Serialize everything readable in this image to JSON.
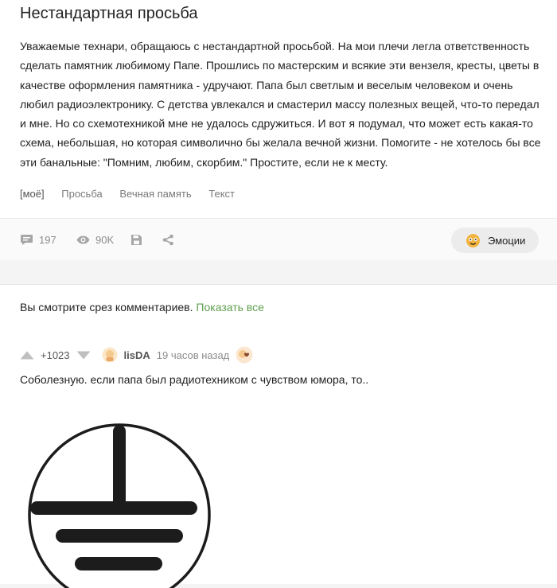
{
  "post": {
    "title": "Нестандартная просьба",
    "body": "Уважаемые технари, обращаюсь с нестандартной просьбой. На мои плечи легла ответственность сделать памятник любимому Папе. Прошлись по мастерским и всякие эти вензеля, кресты, цветы в качестве оформления памятника - удручают. Папа был светлым и веселым человеком и очень любил радиоэлектронику. С детства увлекался и смастерил массу полезных вещей, что-то передал и мне. Но со схемотехникой мне не удалось сдружиться. И вот я подумал, что может есть какая-то схема, небольшая, но которая символично бы желала вечной жизни. Помогите - не хотелось бы все эти банальные: \"Помним, любим, скорбим.\" Простите, если не к месту.",
    "tags": [
      "[моё]",
      "Просьба",
      "Вечная память",
      "Текст"
    ],
    "footer": {
      "comments_count": "197",
      "views_count": "90K",
      "emotions_label": "Эмоции"
    }
  },
  "comments_slice": {
    "text": "Вы смотрите срез комментариев.",
    "show_all_label": "Показать все"
  },
  "comment": {
    "rating": "+1023",
    "username": "lisDA",
    "time": "19 часов назад",
    "text": "Соболезную. если папа был радиотехником с чувством юмора, то.."
  },
  "icons": {
    "comments": "comment-bubble-icon",
    "views": "eye-icon",
    "save": "floppy-disk-icon",
    "share": "share-icon",
    "emotions": "emoji-face-icon",
    "upvote": "upvote-arrow-icon",
    "downvote": "downvote-arrow-icon",
    "avatar": "avatar-icon",
    "badge": "heart-badge-icon",
    "ground_symbol": "protective-earth-ground-icon"
  },
  "colors": {
    "accent_link": "#5fa04e",
    "muted": "#8c8c8c",
    "ground_symbol": "#1c1c1c"
  }
}
